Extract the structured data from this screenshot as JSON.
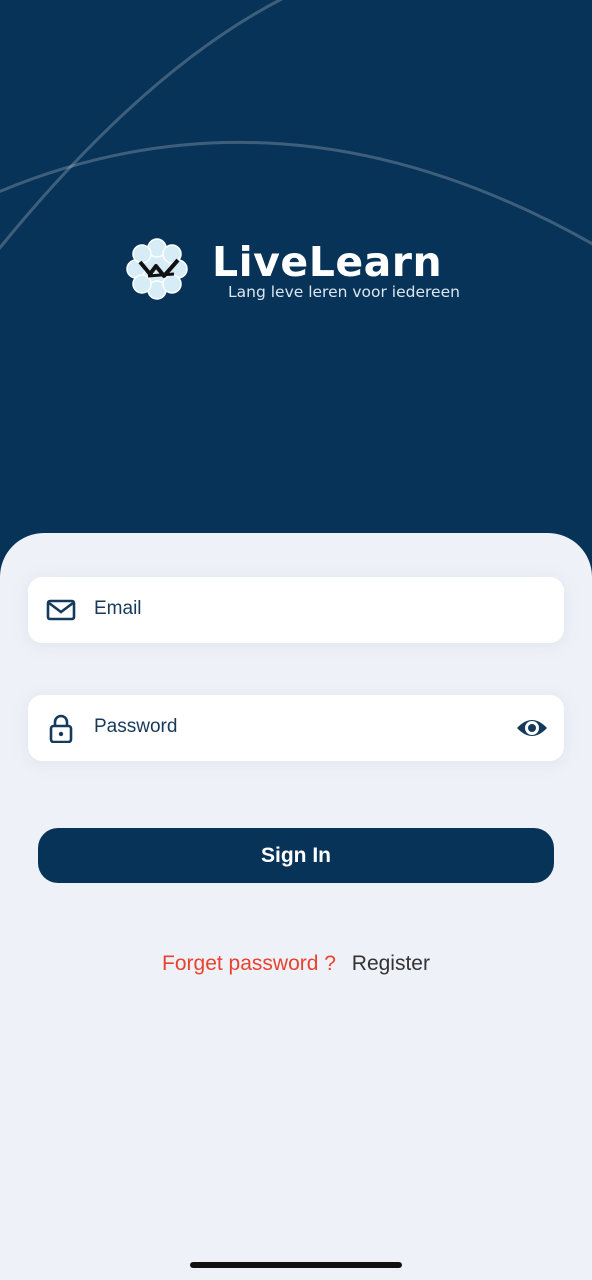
{
  "brand": {
    "name": "LiveLearn",
    "tagline": "Lang leve leren voor iedereen"
  },
  "login": {
    "email": {
      "placeholder": "Email",
      "icon": "mail-icon"
    },
    "password": {
      "placeholder": "Password",
      "icon": "lock-icon",
      "toggle_icon": "eye-icon"
    },
    "submit_label": "Sign In",
    "forgot_label": "Forget password ?",
    "register_label": "Register"
  },
  "colors": {
    "primary": "#083358",
    "panel_background": "#eff1f8",
    "link_accent": "#e8432e"
  }
}
